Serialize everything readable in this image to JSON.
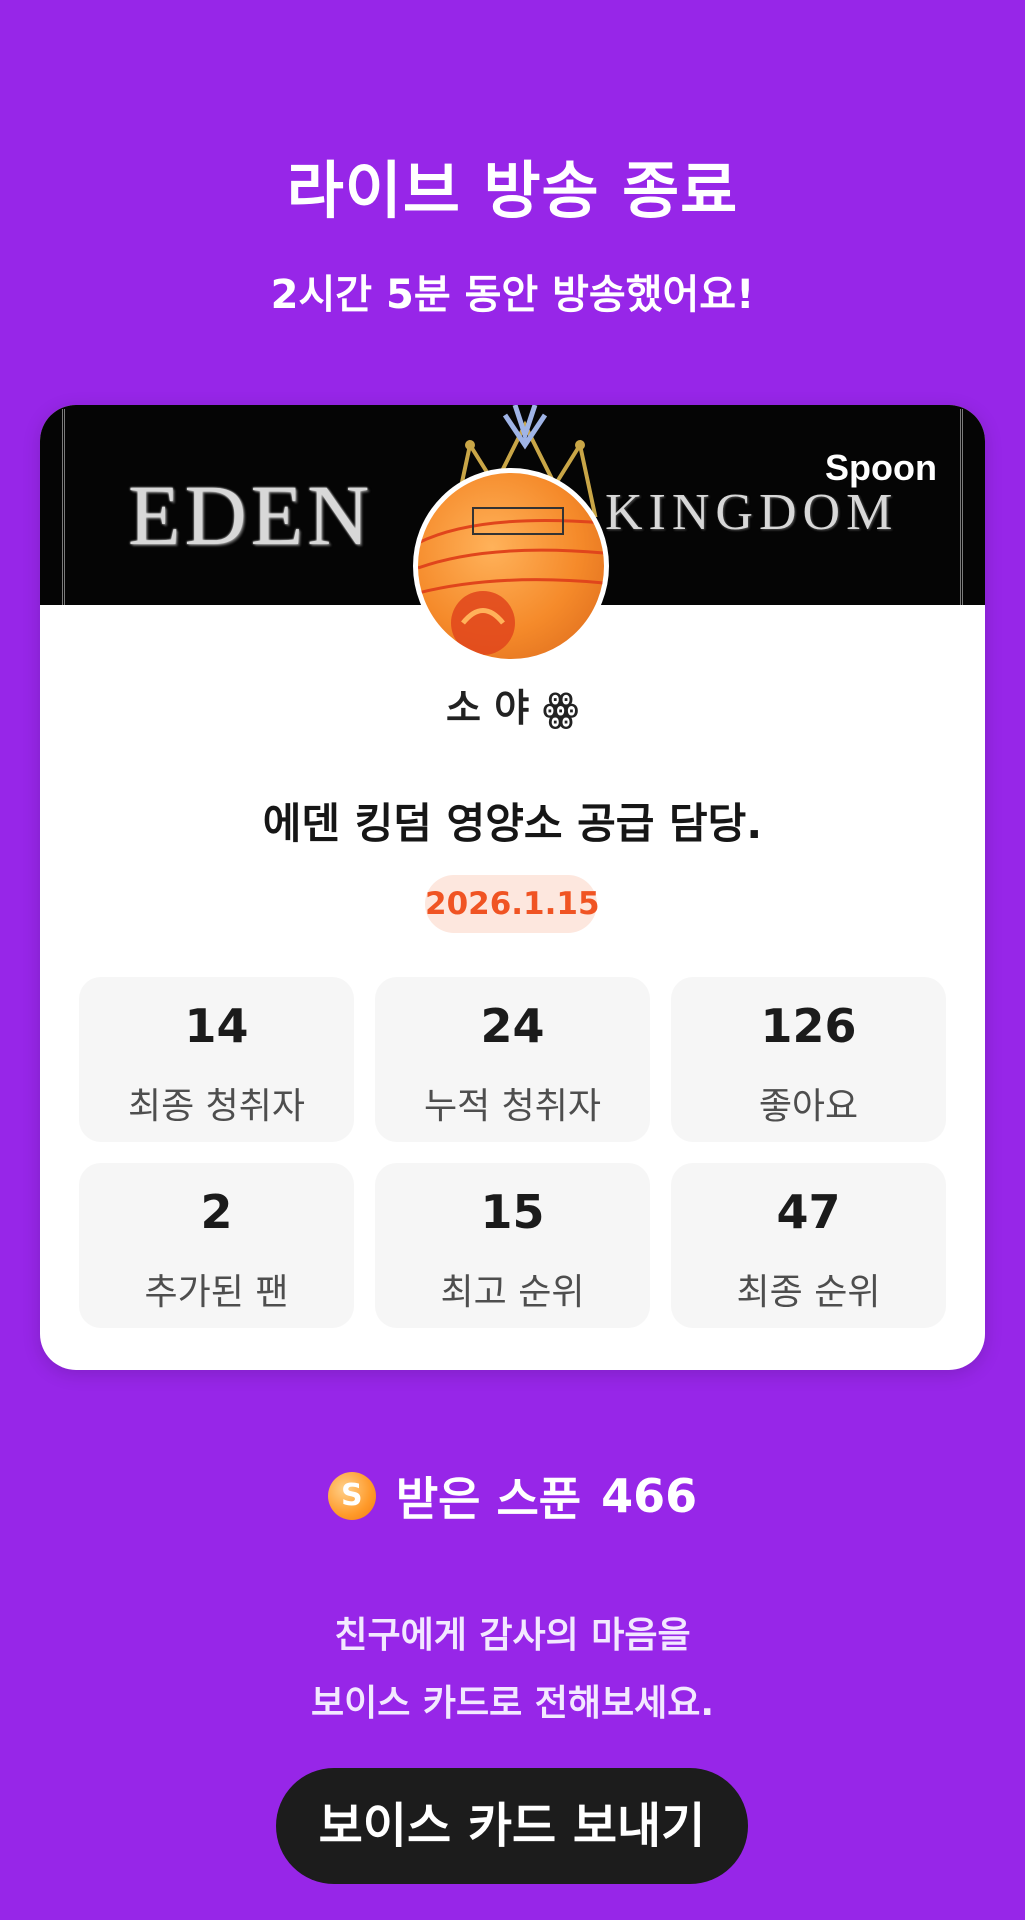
{
  "header": {
    "title": "라이브 방송 종료",
    "subtitle": "2시간 5분 동안 방송했어요!"
  },
  "card": {
    "banner": {
      "text_left": "EDEN",
      "text_right": "KINGDOM",
      "brand": "Spoon"
    },
    "username": "소 야 ꙮ",
    "room_title": "에덴 킹덤 영양소 공급 담당.",
    "date": "2026.1.15",
    "stats": [
      {
        "value": "14",
        "label": "최종 청취자"
      },
      {
        "value": "24",
        "label": "누적 청취자"
      },
      {
        "value": "126",
        "label": "좋아요"
      },
      {
        "value": "2",
        "label": "추가된 팬"
      },
      {
        "value": "15",
        "label": "최고 순위"
      },
      {
        "value": "47",
        "label": "최종 순위"
      }
    ]
  },
  "spoons": {
    "icon_letter": "S",
    "label": "받은 스푼",
    "value": "466"
  },
  "thanks": {
    "line1": "친구에게 감사의 마음을",
    "line2": "보이스 카드로 전해보세요."
  },
  "button": {
    "send_card_label": "보이스 카드 보내기"
  },
  "colors": {
    "background": "#9726e8",
    "badge_text": "#f05423",
    "badge_bg": "#fde7de",
    "button_bg": "#1c1c1c"
  }
}
